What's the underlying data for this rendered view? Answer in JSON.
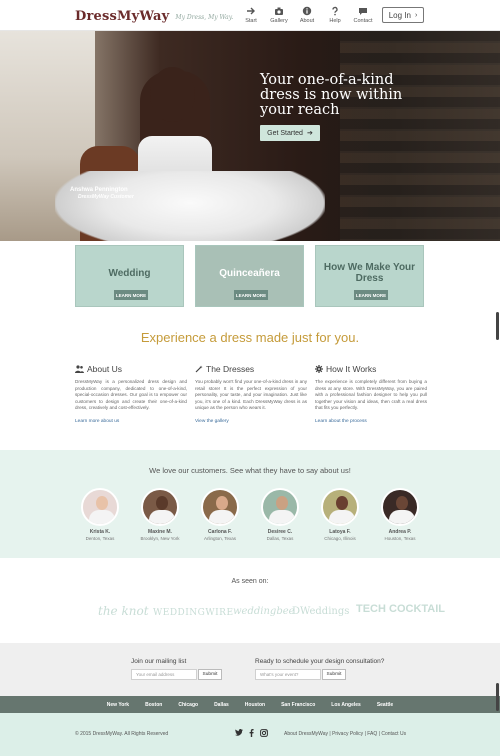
{
  "header": {
    "logo": "DressMyWay",
    "tagline": "My Dress, My Way.",
    "nav": [
      {
        "label": "Start",
        "icon": "arrow-right-icon"
      },
      {
        "label": "Gallery",
        "icon": "camera-icon"
      },
      {
        "label": "About",
        "icon": "info-icon"
      },
      {
        "label": "Help",
        "icon": "question-icon"
      },
      {
        "label": "Contact",
        "icon": "chat-icon"
      }
    ],
    "login_label": "Log In"
  },
  "hero": {
    "headline": "Your one-of-a-kind dress is now within your reach",
    "cta_label": "Get Started",
    "caption_name": "Anshwa Pennington",
    "caption_role": "DressMyWay Customer"
  },
  "tiles": [
    {
      "title": "Wedding",
      "button": "LEARN MORE"
    },
    {
      "title": "Quinceañera",
      "button": "LEARN MORE"
    },
    {
      "title": "How We Make Your Dress",
      "button": "LEARN MORE"
    }
  ],
  "experience": {
    "title": "Experience a dress made just for you.",
    "columns": [
      {
        "heading": "About Us",
        "icon": "people-icon",
        "text": "DressMyWay is a personalized dress design and production company, dedicated to one-of-a-kind, special-occasion dresses. Our goal is to empower our customers to design and create their one-of-a-kind dress, creatively and cost-effectively.",
        "link": "Learn more about us"
      },
      {
        "heading": "The Dresses",
        "icon": "wand-icon",
        "text": "You probably won't find your one-of-a-kind dress in any retail store! It is the perfect expression of your personality, your taste, and your imagination. Just like you, it's one of a kind. Each DressMyWay dress is as unique as the person who wears it.",
        "link": "View the gallery"
      },
      {
        "heading": "How It Works",
        "icon": "gear-icon",
        "text": "The experience is completely different from buying a dress at any store. With DressMyWay, you are paired with a professional fashion designer to help you pull together your vision and ideas, then craft a real dress that fits you perfectly.",
        "link": "Learn about the process"
      }
    ]
  },
  "testimonials": {
    "title": "We love our customers. See what they have to say about us!",
    "people": [
      {
        "name": "Krista K.",
        "location": "Denton, Texas",
        "bg": "#e8d9d6",
        "skin": "#e8c2a8"
      },
      {
        "name": "Maxine M.",
        "location": "Brooklyn, New York",
        "bg": "#7a5a46",
        "skin": "#5a3a2a"
      },
      {
        "name": "Carlona F.",
        "location": "Arlington, Texas",
        "bg": "#8a6a4a",
        "skin": "#d9a98a"
      },
      {
        "name": "Desiree C.",
        "location": "Dallas, Texas",
        "bg": "#9ab8a8",
        "skin": "#caa182"
      },
      {
        "name": "Latoya F.",
        "location": "Chicago, Illinois",
        "bg": "#b7b07a",
        "skin": "#6a4030"
      },
      {
        "name": "Andrea P.",
        "location": "Houston, Texas",
        "bg": "#3a2a26",
        "skin": "#6a4636"
      }
    ]
  },
  "press": {
    "title": "As seen on:",
    "logos": [
      "the knot",
      "WEDDINGWIRE",
      "weddingbee",
      "DWeddings",
      "TECH COCKTAIL"
    ]
  },
  "mailing": {
    "label": "Join our mailing list",
    "placeholder": "Your email address",
    "button": "Submit",
    "consult_label": "Ready to schedule your design consultation?",
    "consult_placeholder": "What's your event?",
    "consult_button": "Submit"
  },
  "cities": [
    "New York",
    "Boston",
    "Chicago",
    "Dallas",
    "Houston",
    "San Francisco",
    "Los Angeles",
    "Seattle"
  ],
  "footer": {
    "copyright": "© 2015 DressMyWay. All Rights Reserved",
    "links": "About DressMyWay | Privacy Policy | FAQ | Contact Us"
  },
  "colors": {
    "accent_gold": "#c59b3a",
    "mint": "#b9d6cc",
    "dark_green": "#66766f"
  }
}
